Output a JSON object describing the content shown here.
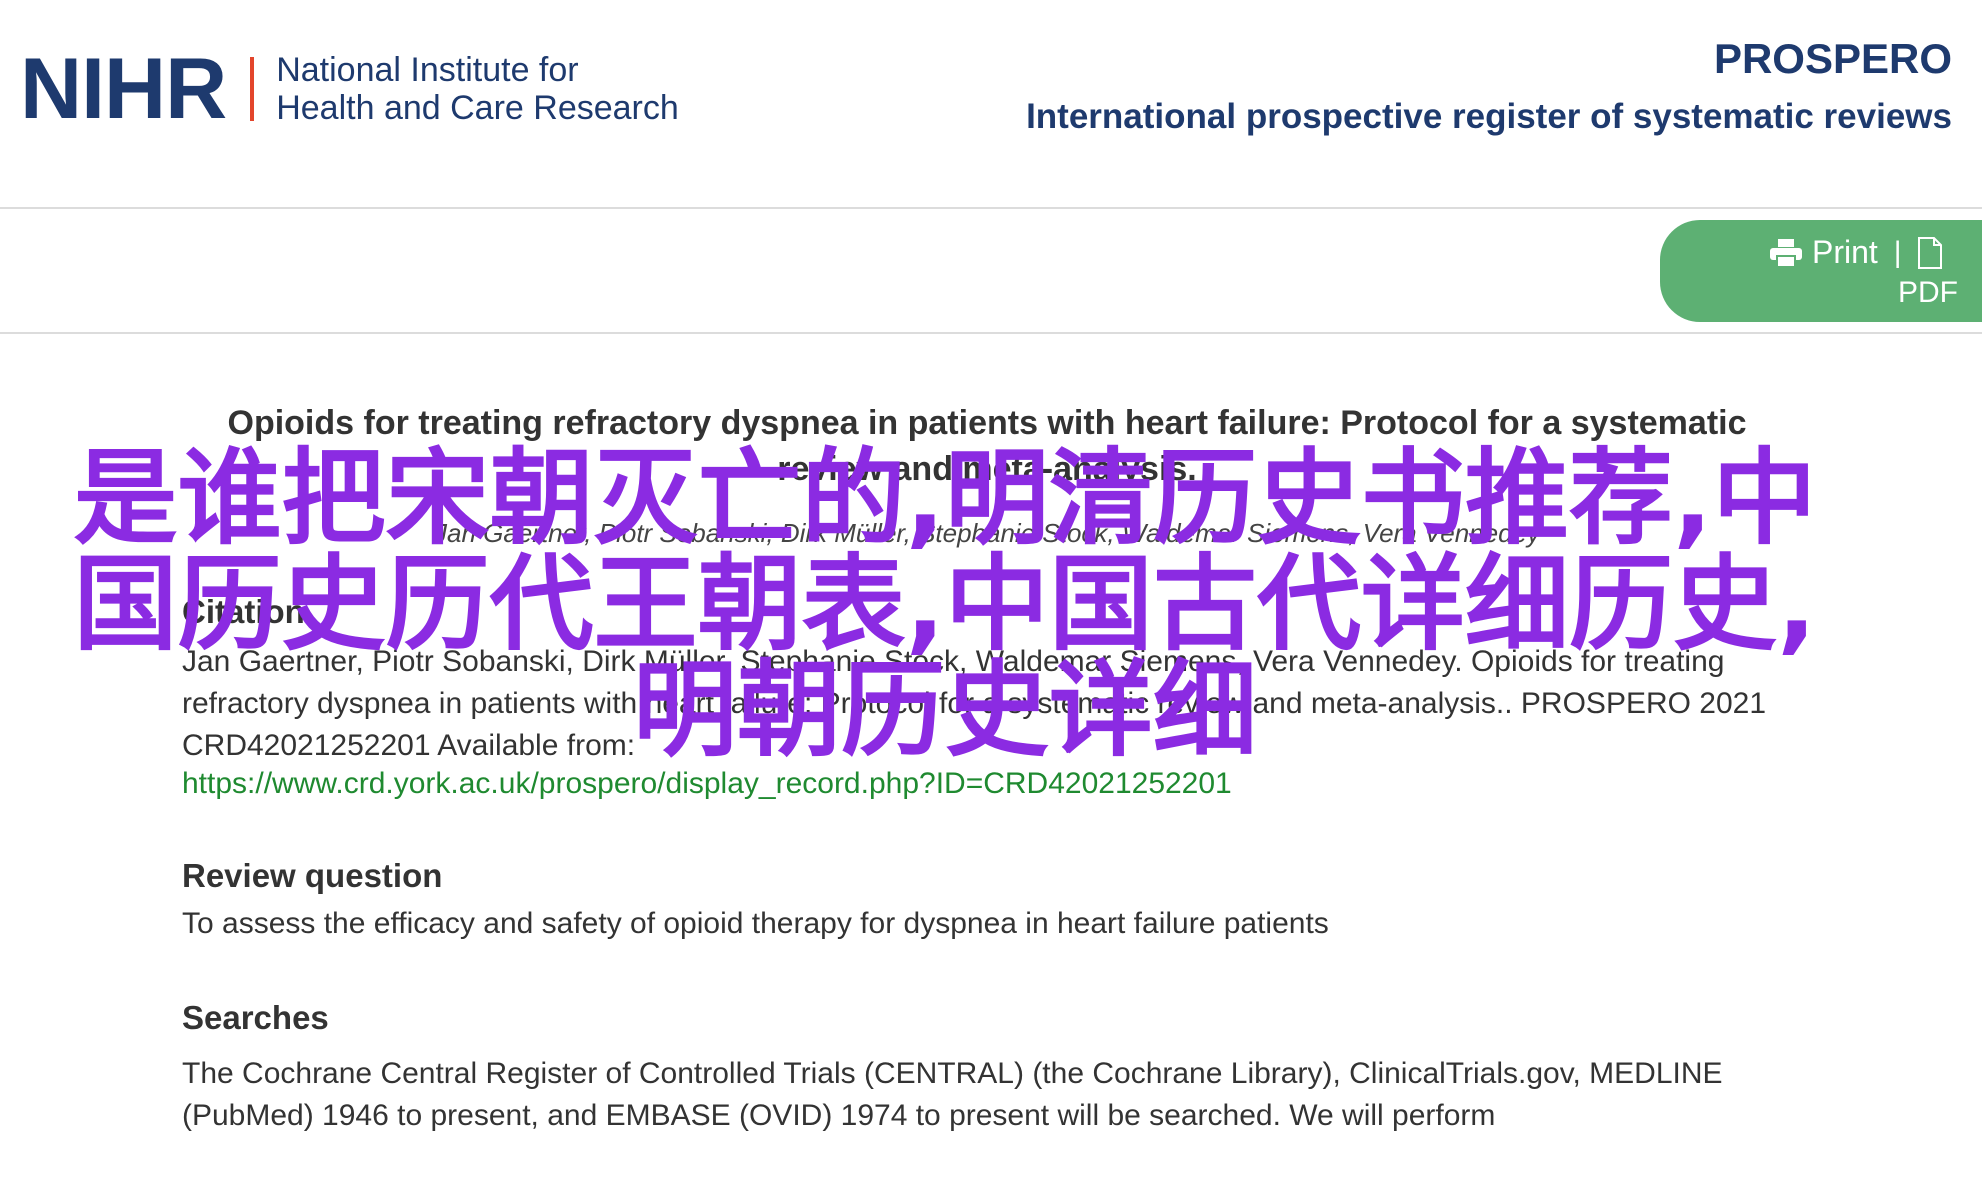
{
  "header": {
    "logo_mark": "NIHR",
    "logo_line1": "National Institute for",
    "logo_line2": "Health and Care Research",
    "brand_title": "PROSPERO",
    "brand_subtitle": "International prospective register of systematic reviews"
  },
  "toolbar": {
    "print_label": "Print",
    "separator": "|",
    "pdf_label": "PDF",
    "button_color": "#5db073"
  },
  "record": {
    "title": "Opioids for treating refractory dyspnea in patients with heart failure: Protocol for a systematic review and meta-analysis.",
    "authors": "Jan Gaertner, Piotr Sobanski, Dirk Müller, Stephanie Stock, Waldemar Siemens, Vera Vennedey",
    "citation_heading": "Citation",
    "citation_text": "Jan Gaertner, Piotr Sobanski, Dirk Müller, Stephanie Stock, Waldemar Siemens, Vera Vennedey. Opioids for treating refractory dyspnea in patients with heart failure: Protocol for a systematic review and meta-analysis.. PROSPERO 2021 CRD42021252201 Available from:",
    "citation_link": "https://www.crd.york.ac.uk/prospero/display_record.php?ID=CRD42021252201",
    "review_question_heading": "Review question",
    "review_question_text": "To assess the efficacy and safety of opioid therapy for dyspnea in heart failure patients",
    "searches_heading": "Searches",
    "searches_text": "The Cochrane Central Register of Controlled Trials (CENTRAL) (the Cochrane Library), ClinicalTrials.gov, MEDLINE (PubMed) 1946 to present, and EMBASE (OVID) 1974 to present will be searched. We will perform"
  },
  "overlay": {
    "text": "是谁把宋朝灭亡的,明清历史书推荐,中国历史历代王朝表,中国古代详细历史,明朝历史详细",
    "color": "#8b2be2"
  },
  "colors": {
    "brand_navy": "#1e3a6e",
    "logo_accent": "#e3452b",
    "link_green": "#1f8a30"
  }
}
